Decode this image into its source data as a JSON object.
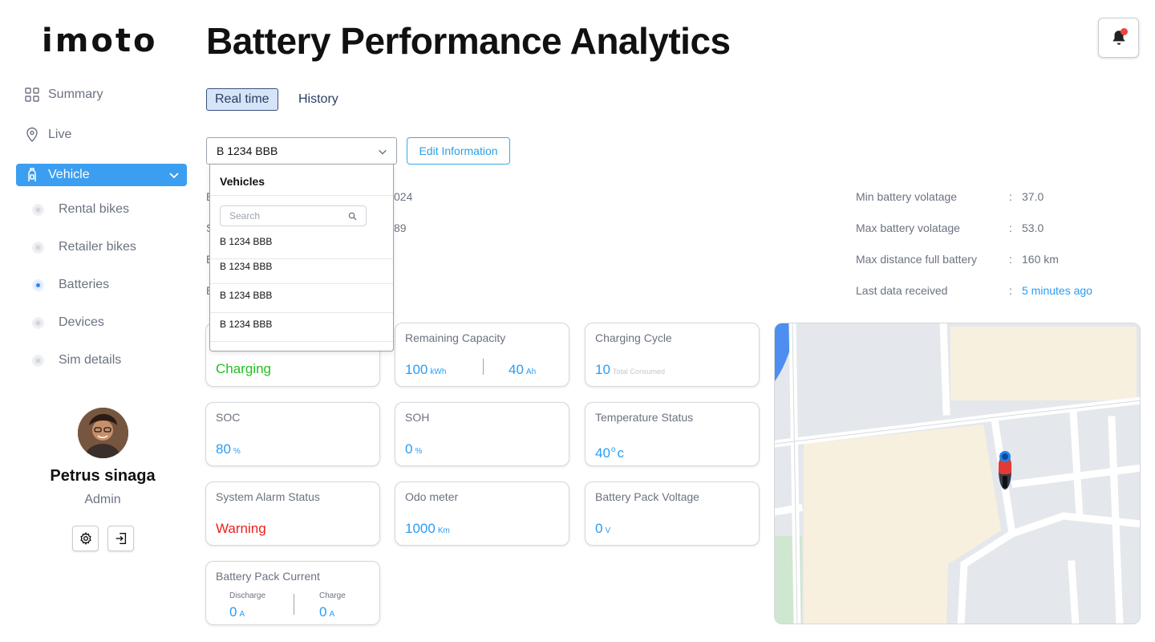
{
  "app": {
    "logo": "imoto",
    "title": "Battery Performance Analytics"
  },
  "sidebar": {
    "items": [
      {
        "label": "Summary",
        "icon": "grid-icon"
      },
      {
        "label": "Live",
        "icon": "location-pin-icon"
      },
      {
        "label": "Vehicle",
        "icon": "vehicle-icon",
        "active": true
      }
    ],
    "subitems": [
      {
        "label": "Rental bikes"
      },
      {
        "label": "Retailer bikes"
      },
      {
        "label": "Batteries",
        "selected": true
      },
      {
        "label": "Devices"
      },
      {
        "label": "Sim details"
      }
    ],
    "user": {
      "name": "Petrus sinaga",
      "role": "Admin"
    }
  },
  "tabs": [
    {
      "label": "Real time",
      "active": true
    },
    {
      "label": "History",
      "active": false
    }
  ],
  "vehicle_select": {
    "value": "B 1234 BBB"
  },
  "edit_button": "Edit Information",
  "info_fragments": {
    "row1_left": "E",
    "row1_right": "024",
    "row2_left": "S",
    "row2_right": "89",
    "row3_left": "E",
    "row4_left": "E"
  },
  "specs": [
    {
      "label": "Min battery volatage",
      "value": "37.0"
    },
    {
      "label": "Max battery volatage",
      "value": "53.0"
    },
    {
      "label": "Max distance full battery",
      "value": "160 km"
    },
    {
      "label": "Last data received",
      "value": "5 minutes ago",
      "link": true
    }
  ],
  "cards": {
    "status": {
      "value": "Charging"
    },
    "remaining_capacity": {
      "title": "Remaining Capacity",
      "kwh": "100",
      "kwh_unit": "kWh",
      "ah": "40",
      "ah_unit": "Ah"
    },
    "charging_cycle": {
      "title": "Charging Cycle",
      "value": "10",
      "note": "Total Consumed"
    },
    "soc": {
      "title": "SOC",
      "value": "80",
      "unit": "%"
    },
    "soh": {
      "title": "SOH",
      "value": "0",
      "unit": "%"
    },
    "temperature": {
      "title": "Temperature Status",
      "value": "40",
      "degree": "o",
      "unit": "c"
    },
    "alarm": {
      "title": "System Alarm Status",
      "value": "Warning"
    },
    "odometer": {
      "title": "Odo meter",
      "value": "1000",
      "unit": "Km"
    },
    "pack_voltage": {
      "title": "Battery Pack Voltage",
      "value": "0",
      "unit": "V"
    },
    "pack_current": {
      "title": "Battery Pack Current",
      "discharge_label": "Discharge",
      "discharge_value": "0",
      "discharge_unit": "A",
      "charge_label": "Charge",
      "charge_value": "0",
      "charge_unit": "A"
    }
  },
  "dropdown": {
    "title": "Vehicles",
    "search_placeholder": "Search",
    "items": [
      "B 1234 BBB",
      "B 1234 BBB",
      "B 1234 BBB",
      "B 1234 BBB"
    ]
  },
  "colors": {
    "accent": "#3b9ef1",
    "value_blue": "#2b9cf2",
    "charging_green": "#22c020",
    "warning_red": "#ef1c1c",
    "notification_dot": "#ef4444"
  }
}
